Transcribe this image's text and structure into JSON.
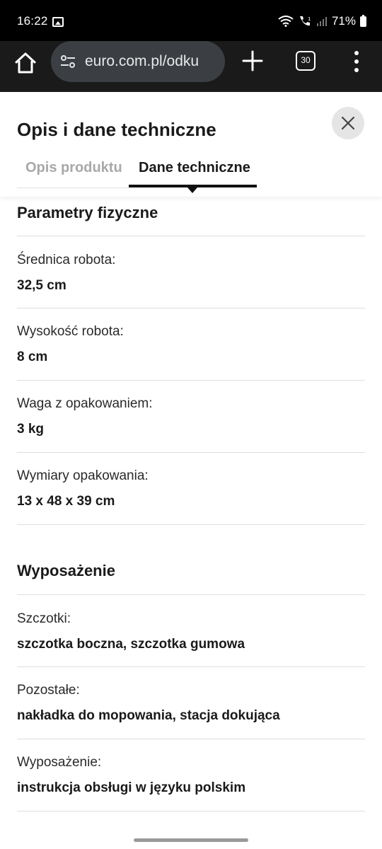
{
  "status_bar": {
    "time": "16:22",
    "battery": "71%"
  },
  "browser": {
    "url": "euro.com.pl/odku",
    "tab_count": "30"
  },
  "sheet": {
    "title": "Opis i dane techniczne",
    "tabs": [
      {
        "label": "Opis produktu",
        "active": false
      },
      {
        "label": "Dane techniczne",
        "active": true
      }
    ]
  },
  "sections": [
    {
      "title": "Parametry fizyczne",
      "params": [
        {
          "label": "Średnica robota:",
          "value": "32,5 cm"
        },
        {
          "label": "Wysokość robota:",
          "value": "8 cm"
        },
        {
          "label": "Waga z opakowaniem:",
          "value": "3 kg"
        },
        {
          "label": "Wymiary opakowania:",
          "value": "13 x 48 x 39 cm"
        }
      ]
    },
    {
      "title": "Wyposażenie",
      "params": [
        {
          "label": "Szczotki:",
          "value": "szczotka boczna, szczotka gumowa"
        },
        {
          "label": "Pozostałe:",
          "value": "nakładka do mopowania, stacja dokująca"
        },
        {
          "label": "Wyposażenie:",
          "value": "instrukcja obsługi w języku polskim"
        }
      ]
    }
  ],
  "colors": {
    "accent": "#111111",
    "inactive_tab": "#a8a8a8",
    "browser_bg": "#1a1a1a",
    "url_pill": "#3b3f44"
  }
}
